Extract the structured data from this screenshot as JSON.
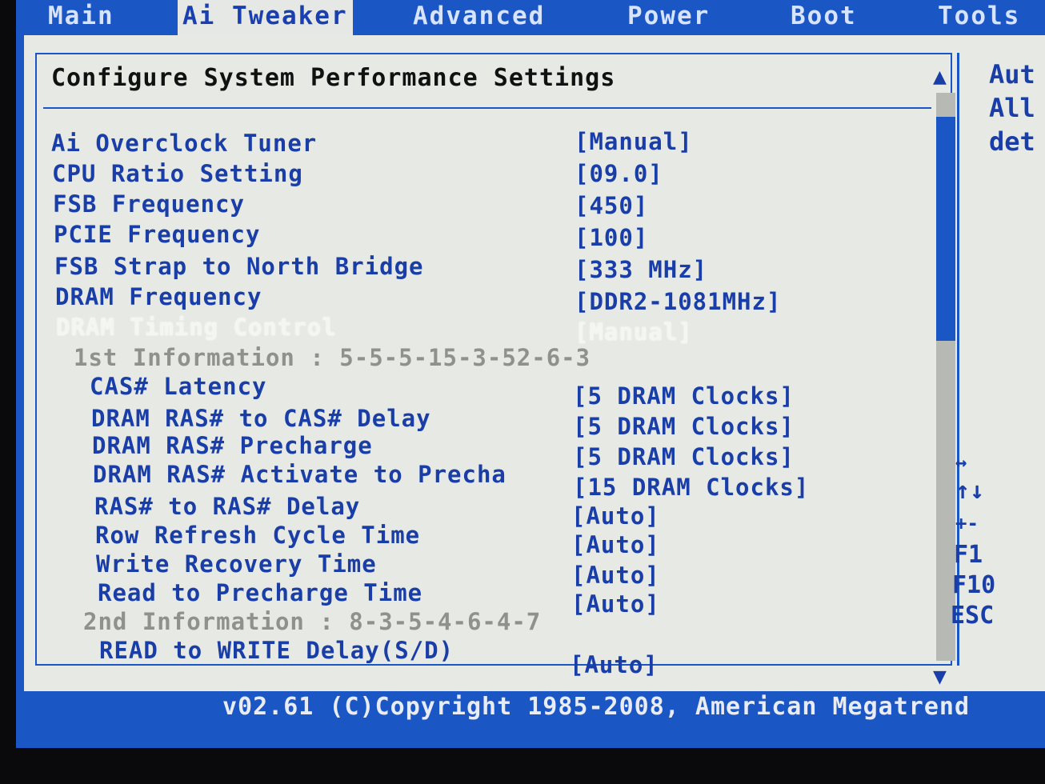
{
  "menu": {
    "tabs": [
      {
        "label": "Main"
      },
      {
        "label": "Ai Tweaker"
      },
      {
        "label": "Advanced"
      },
      {
        "label": "Power"
      },
      {
        "label": "Boot"
      },
      {
        "label": "Tools"
      }
    ]
  },
  "panel": {
    "title": "Configure System Performance Settings"
  },
  "settings": [
    {
      "label": "Ai Overclock Tuner",
      "value": "[Manual]"
    },
    {
      "label": "CPU Ratio Setting",
      "value": "[09.0]"
    },
    {
      "label": "FSB Frequency",
      "value": "[450]"
    },
    {
      "label": "PCIE Frequency",
      "value": "[100]"
    },
    {
      "label": "FSB Strap to North Bridge",
      "value": "[333 MHz]"
    },
    {
      "label": "DRAM Frequency",
      "value": "[DDR2-1081MHz]"
    },
    {
      "label": "DRAM Timing Control",
      "value": "[Manual]"
    },
    {
      "label": "1st Information : 5-5-5-15-3-52-6-3"
    },
    {
      "label": "CAS# Latency",
      "value": "[5 DRAM Clocks]"
    },
    {
      "label": "DRAM RAS# to CAS# Delay",
      "value": "[5 DRAM Clocks]"
    },
    {
      "label": "DRAM RAS# Precharge",
      "value": "[5 DRAM Clocks]"
    },
    {
      "label": "DRAM RAS# Activate to Precha",
      "value": "[15 DRAM Clocks]"
    },
    {
      "label": "RAS# to RAS# Delay",
      "value": "[Auto]"
    },
    {
      "label": "Row Refresh Cycle Time",
      "value": "[Auto]"
    },
    {
      "label": "Write Recovery Time",
      "value": "[Auto]"
    },
    {
      "label": "Read to Precharge Time",
      "value": "[Auto]"
    },
    {
      "label": "2nd Information : 8-3-5-4-6-4-7"
    },
    {
      "label": "READ to WRITE Delay(S/D)",
      "value": "[Auto]"
    }
  ],
  "help": {
    "lines": [
      "Aut",
      "All",
      "det"
    ],
    "keys": [
      "↔",
      "↑↓",
      "+-",
      "F1",
      "F10",
      "ESC"
    ]
  },
  "footer": {
    "text": "v02.61 (C)Copyright 1985-2008, American Megatrend"
  },
  "colors": {
    "background": "#1a56c4",
    "panel": "#e7e9e5",
    "text": "#1a3ea8",
    "selected": "#f4f6f2",
    "info": "#8e918c"
  }
}
